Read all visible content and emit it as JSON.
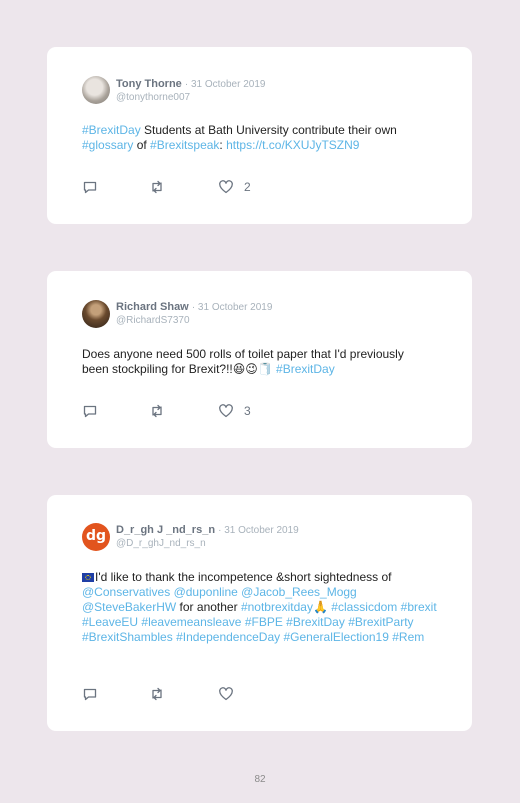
{
  "tweets": [
    {
      "name": "Tony Thorne",
      "date": "· 31 October 2019",
      "handle": "@tonythorne007",
      "likes": "2",
      "segments": [
        {
          "text": "#BrexitDay",
          "tag": true
        },
        {
          "text": " Students at Bath University contribute their own ",
          "tag": false
        },
        {
          "text": "#glossary",
          "tag": true
        },
        {
          "text": " of ",
          "tag": false
        },
        {
          "text": "#Brexitspeak",
          "tag": true
        },
        {
          "text": ": ",
          "tag": false
        },
        {
          "text": "https://t.co/KXUJyTSZN9",
          "tag": true
        }
      ]
    },
    {
      "name": "Richard Shaw",
      "date": "· 31 October 2019",
      "handle": "@RichardS7370",
      "likes": "3",
      "segments": [
        {
          "text": "Does anyone need 500 rolls of toilet paper that I'd previously been stockpiling for Brexit?!!",
          "tag": false
        },
        {
          "text": "😆😉🧻 ",
          "tag": false
        },
        {
          "text": "#BrexitDay",
          "tag": true
        }
      ]
    },
    {
      "name": "D_r_gh J _nd_rs_n",
      "date": "· 31 October 2019",
      "handle": "@D_r_ghJ_nd_rs_n",
      "avatar_text": "dg",
      "likes": "",
      "segments": [
        {
          "text": "I'd like to thank the incompetence &short sightedness of ",
          "tag": false
        },
        {
          "text": "@Conservatives",
          "tag": true
        },
        {
          "text": " ",
          "tag": false
        },
        {
          "text": "@duponline",
          "tag": true
        },
        {
          "text": " ",
          "tag": false
        },
        {
          "text": "@Jacob_Rees_Mogg",
          "tag": true
        },
        {
          "text": " ",
          "tag": false
        },
        {
          "text": "@SteveBakerHW",
          "tag": true
        },
        {
          "text": " for another ",
          "tag": false
        },
        {
          "text": "#notbrexitday",
          "tag": true
        },
        {
          "text": "🙏 ",
          "tag": false
        },
        {
          "text": "#classicdom",
          "tag": true
        },
        {
          "text": " ",
          "tag": false
        },
        {
          "text": "#brexit",
          "tag": true
        },
        {
          "text": " ",
          "tag": false
        },
        {
          "text": "#LeaveEU",
          "tag": true
        },
        {
          "text": " ",
          "tag": false
        },
        {
          "text": "#leavemeansleave",
          "tag": true
        },
        {
          "text": " ",
          "tag": false
        },
        {
          "text": "#FBPE",
          "tag": true
        },
        {
          "text": " ",
          "tag": false
        },
        {
          "text": "#BrexitDay",
          "tag": true
        },
        {
          "text": " ",
          "tag": false
        },
        {
          "text": "#BrexitParty",
          "tag": true
        },
        {
          "text": " ",
          "tag": false
        },
        {
          "text": "#BrexitShambles",
          "tag": true
        },
        {
          "text": " ",
          "tag": false
        },
        {
          "text": "#IndependenceDay",
          "tag": true
        },
        {
          "text": " ",
          "tag": false
        },
        {
          "text": "#GeneralElection19",
          "tag": true
        },
        {
          "text": " ",
          "tag": false
        },
        {
          "text": "#Rem",
          "tag": true
        }
      ]
    }
  ],
  "colors": {
    "background": "#ede6ec",
    "link": "#5db5e6",
    "meta": "#a8b2bb"
  },
  "icons": [
    "reply-icon",
    "retweet-icon",
    "like-icon"
  ],
  "page_number": "82"
}
